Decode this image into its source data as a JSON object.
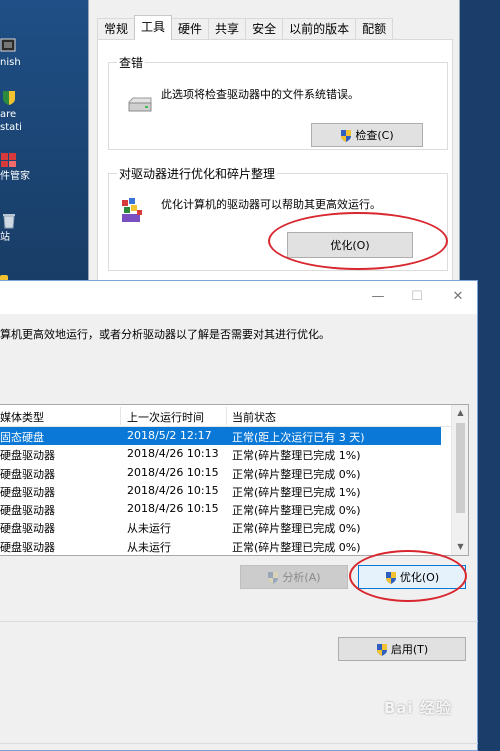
{
  "desktop": {
    "icons": [
      {
        "label": "nish"
      },
      {
        "label_lines": [
          "are",
          "stati"
        ]
      },
      {
        "label": "件管家"
      },
      {
        "label": "站"
      }
    ]
  },
  "props": {
    "tabs": [
      "常规",
      "工具",
      "硬件",
      "共享",
      "安全",
      "以前的版本",
      "配额"
    ],
    "active_tab": "工具",
    "check": {
      "title": "查错",
      "desc": "此选项将检查驱动器中的文件系统错误。",
      "button": "检查(C)"
    },
    "optimize": {
      "title": "对驱动器进行优化和碎片整理",
      "desc": "优化计算机的驱动器可以帮助其更高效运行。",
      "button": "优化(O)"
    }
  },
  "optwin": {
    "controls": {
      "minimize": "—",
      "maximize": "☐",
      "close": "✕"
    },
    "intro": "算机更高效地运行，或者分析驱动器以了解是否需要对其进行优化。",
    "columns": [
      "媒体类型",
      "上一次运行时间",
      "当前状态"
    ],
    "rows": [
      {
        "media": "固态硬盘",
        "last": "2018/5/2 12:17",
        "status": "正常(距上次运行已有 3 天)",
        "selected": true
      },
      {
        "media": "硬盘驱动器",
        "last": "2018/4/26 10:13",
        "status": "正常(碎片整理已完成 1%)"
      },
      {
        "media": "硬盘驱动器",
        "last": "2018/4/26 10:15",
        "status": "正常(碎片整理已完成 0%)"
      },
      {
        "media": "硬盘驱动器",
        "last": "2018/4/26 10:15",
        "status": "正常(碎片整理已完成 1%)"
      },
      {
        "media": "硬盘驱动器",
        "last": "2018/4/26 10:15",
        "status": "正常(碎片整理已完成 0%)"
      },
      {
        "media": "硬盘驱动器",
        "last": "从未运行",
        "status": "正常(碎片整理已完成 0%)"
      },
      {
        "media": "硬盘驱动器",
        "last": "从未运行",
        "status": "正常(碎片整理已完成 0%)"
      }
    ],
    "analyze_button": "分析(A)",
    "optimize_button": "优化(O)",
    "enable_button": "启用(T)"
  },
  "watermark": "Bai 经验",
  "colors": {
    "selection": "#0a78d7",
    "annotation": "#d8272e",
    "shield_blue": "#2f5fbf",
    "shield_yellow": "#f2c230"
  }
}
